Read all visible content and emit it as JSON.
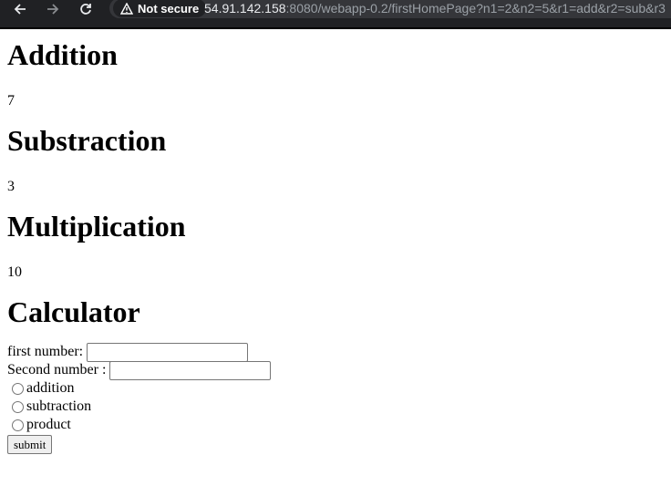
{
  "browser": {
    "security_label": "Not secure",
    "url_host": "54.91.142.158",
    "url_rest": ":8080/webapp-0.2/firstHomePage?n1=2&n2=5&r1=add&r2=sub&r3"
  },
  "results": {
    "addition_title": "Addition",
    "addition_value": "7",
    "subtraction_title": "Substraction",
    "subtraction_value": "3",
    "multiplication_title": "Multiplication",
    "multiplication_value": "10"
  },
  "calculator": {
    "title": "Calculator",
    "first_label": "first number:",
    "first_value": "",
    "second_label": "Second number :",
    "second_value": "",
    "options": [
      "addition",
      "subtraction",
      "product"
    ],
    "submit_label": "submit"
  }
}
